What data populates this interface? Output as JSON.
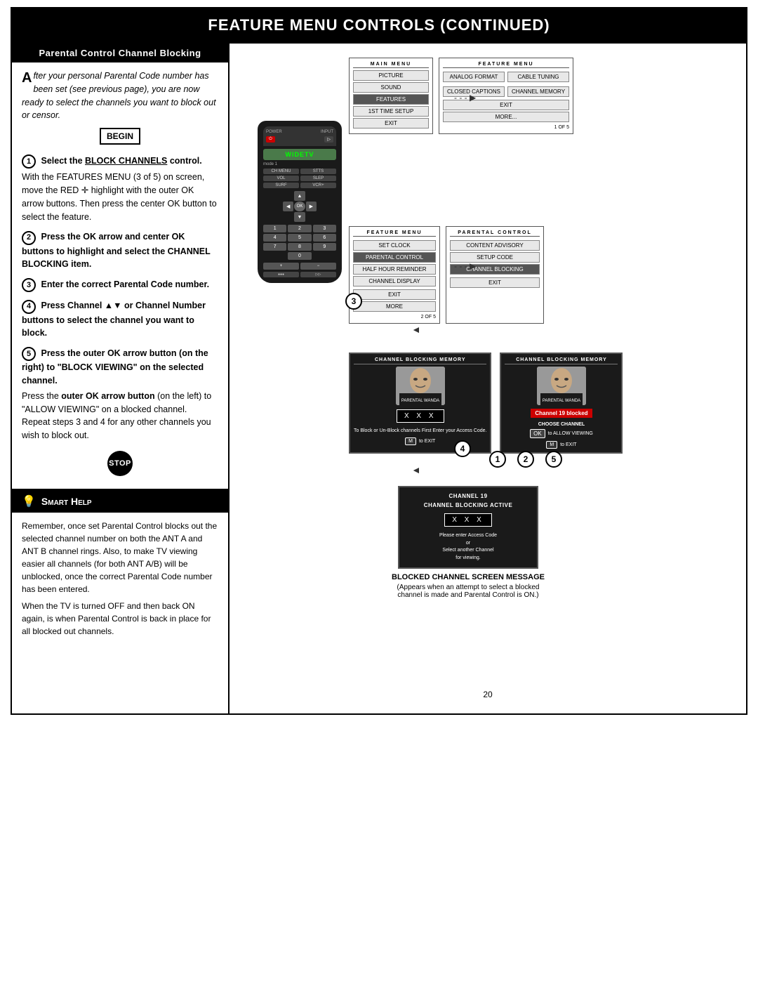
{
  "header": {
    "title": "Feature Menu Controls (Continued)"
  },
  "left_panel": {
    "section_title": "Parental Control Channel Blocking",
    "intro": {
      "drop_cap": "A",
      "text": "fter your personal Parental Code number has been set (see previous page), you are now ready to select the channels you want to block out or censor."
    },
    "begin_label": "BEGIN",
    "steps": [
      {
        "number": "1",
        "title": "Select the BLOCK CHANNELS control.",
        "body": "With the FEATURES MENU (3 of 5) on screen, move the RED highlight with the outer OK arrow buttons. Then press the center OK button to select the feature."
      },
      {
        "number": "2",
        "title": "Press the OK arrow and center OK buttons to highlight and select the CHANNEL BLOCKING item.",
        "body": ""
      },
      {
        "number": "3",
        "title": "Enter the correct Parental Code number.",
        "body": ""
      },
      {
        "number": "4",
        "title": "Press Channel ▲▼ or Channel Number buttons to select the channel you want to block.",
        "body": ""
      },
      {
        "number": "5",
        "title": "Press the outer OK arrow button (on the right) to \"BLOCK VIEWING\" on the selected channel.",
        "body": "Press the outer OK arrow button (on the left) to \"ALLOW VIEWING\" on a blocked channel.\nRepeat steps 3 and 4 for any other channels you wish to block out."
      }
    ],
    "stop_label": "STOP"
  },
  "smart_help": {
    "title": "Smart Help",
    "content": "Remember, once set Parental Control blocks out the selected channel number on both the ANT A and ANT B channel rings. Also, to make TV viewing easier all channels (for both ANT A/B) will be unblocked, once the correct Parental Code number has been entered.\nWhen the TV is turned OFF and then back ON again, is when Parental Control is back in place for all blocked out channels."
  },
  "right_panel": {
    "menu1": {
      "title": "MAIN MENU",
      "items": [
        "PICTURE",
        "SOUND",
        "FEATURES",
        "1ST TIME SETUP",
        "EXIT"
      ],
      "feature_menu_title": "FEATURE MENU",
      "feature_items": [
        "ANALOG FORMAT",
        "CABLE TUNING",
        "CLOSED CAPTIONS",
        "CHANNEL MEMORY",
        "EXIT",
        "MORE...",
        "1 OF 5"
      ]
    },
    "menu2": {
      "feature_menu_title": "FEATURE MENU",
      "feature_items": [
        "SET CLOCK",
        "PARENTAL CONTROL",
        "HALF HOUR REMINDER",
        "CHANNEL DISPLAY",
        "EXIT",
        "MORE",
        "2 OF 5"
      ],
      "parental_title": "PARENTAL CONTROL",
      "parental_items": [
        "CONTENT ADVISORY",
        "SETUP CODE",
        "CHANNEL BLOCKING"
      ]
    },
    "channel_screens": {
      "screen1": {
        "title": "CHANNEL BLOCKING MEMORY",
        "code_display": "X X X",
        "instruction": "To Block or Un-Block channels First Enter your Access Code.",
        "m_label": "M",
        "m_text": "to EXIT",
        "face_label": "PARENTAL WANDA"
      },
      "screen2": {
        "title": "CHANNEL BLOCKING MEMORY",
        "code_display": "Channel 19 blocked",
        "choose_label": "CHOOSE CHANNEL",
        "ok_label": "OK",
        "ok_text": "to ALLOW VIEWING",
        "m_label": "M",
        "m_text": "to EXIT",
        "face_label": "PARENTAL WANDA"
      }
    },
    "blocked_screen": {
      "header1": "CHANNEL 19",
      "header2": "CHANNEL BLOCKING ACTIVE",
      "code_display": "X X X",
      "message1": "Please enter Access Code",
      "message2": "or",
      "message3": "Select another Channel",
      "message4": "for viewing."
    },
    "blocked_caption": "BLOCKED CHANNEL SCREEN MESSAGE",
    "blocked_sub": "(Appears when an attempt to select a blocked channel is made and Parental Control is ON.)",
    "remote": {
      "screen_text": "WIDETV",
      "mode1": "mode 1",
      "channel_label": "CH MENU STTS",
      "volume_label": "VOL SLEP",
      "surf_label": "SURF VCR+"
    }
  },
  "page_number": "20"
}
